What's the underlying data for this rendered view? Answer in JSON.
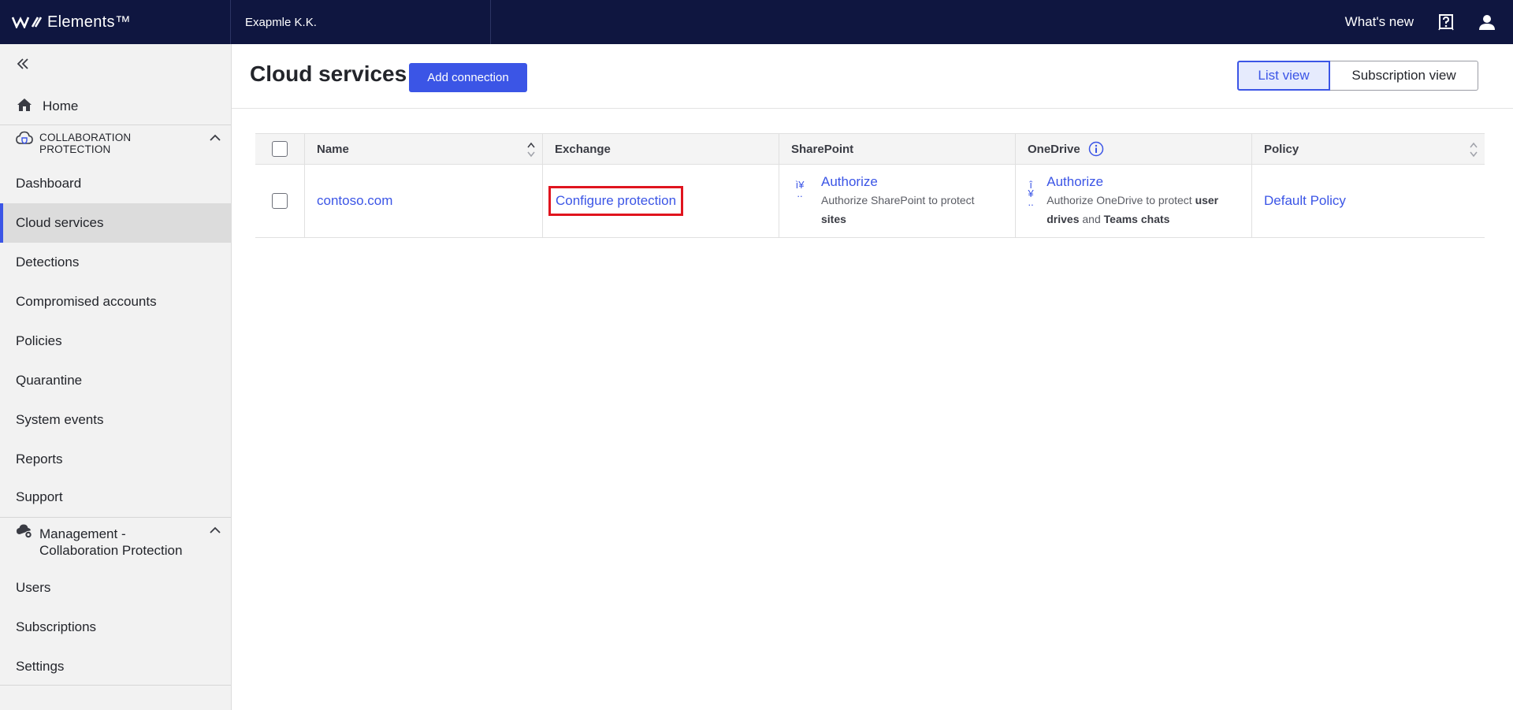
{
  "topbar": {
    "brand": "Elements™",
    "org": "Exapmle K.K.",
    "whats_new": "What's new"
  },
  "icons": {
    "logo": "brand-logo-icon",
    "help": "help-icon",
    "user": "user-icon",
    "collapse": "double-chevron-left-icon",
    "home": "home-icon",
    "cloud_shield": "cloud-shield-icon",
    "cloud_gear": "cloud-gear-icon",
    "chevron_up": "chevron-up-icon",
    "info": "info-icon",
    "sort": "sort-icon"
  },
  "sidebar": {
    "home": "Home",
    "section1": {
      "line1": "COLLABORATION",
      "line2": "PROTECTION"
    },
    "items1": [
      "Dashboard",
      "Cloud services",
      "Detections",
      "Compromised accounts",
      "Policies",
      "Quarantine",
      "System events",
      "Reports",
      "Support"
    ],
    "section2": {
      "line1": "Management -",
      "line2": "Collaboration Protection"
    },
    "items2": [
      "Users",
      "Subscriptions",
      "Settings"
    ]
  },
  "main": {
    "title": "Cloud services",
    "add_connection": "Add connection",
    "list_view": "List view",
    "subscription_view": "Subscription view"
  },
  "table": {
    "headers": [
      "Name",
      "Exchange",
      "SharePoint",
      "OneDrive",
      "Policy"
    ],
    "row": {
      "name": "contoso.com",
      "exchange": "Configure protection",
      "sharepoint": {
        "glyph_top": "ì¥",
        "glyph_bottom": "..",
        "link": "Authorize",
        "desc_prefix": "Authorize SharePoint to protect ",
        "desc_bold": "sites"
      },
      "onedrive": {
        "glyph_top": "î",
        "glyph_mid": "¥",
        "glyph_bottom": "..",
        "link": "Authorize",
        "desc_prefix": "Authorize OneDrive to protect ",
        "desc_bold1": "user drives",
        "desc_mid": " and ",
        "desc_bold2": "Teams chats"
      },
      "policy": "Default Policy"
    }
  },
  "colors": {
    "topbar": "#0f1640",
    "accent": "#3b55e6",
    "highlight": "#e0141e",
    "sidebar_bg": "#f2f2f2"
  }
}
